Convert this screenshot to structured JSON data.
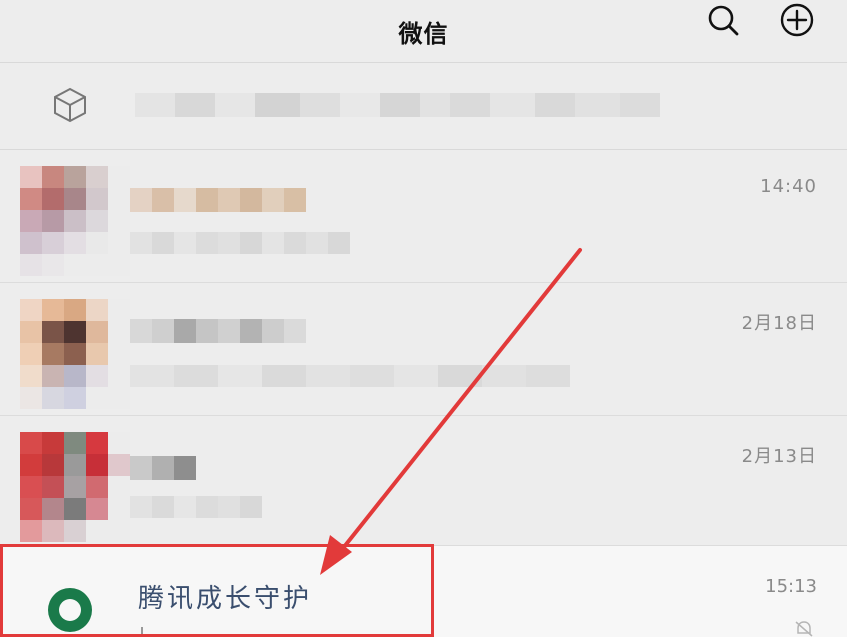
{
  "header": {
    "title": "微信",
    "search_icon": "search-icon",
    "add_icon": "plus-circle-icon"
  },
  "device_row": {
    "icon": "cube-icon"
  },
  "chats": [
    {
      "time": "14:40"
    },
    {
      "time": "2月18日"
    },
    {
      "time": "2月13日"
    }
  ],
  "highlighted_chat": {
    "name": "腾讯成长守护",
    "time": "15:13",
    "icon": "tencent-growth-guardian-icon",
    "mute_icon": "mute-bell-icon"
  },
  "annotation": {
    "box_color": "#e23a3a",
    "arrow_color": "#e23a3a"
  }
}
